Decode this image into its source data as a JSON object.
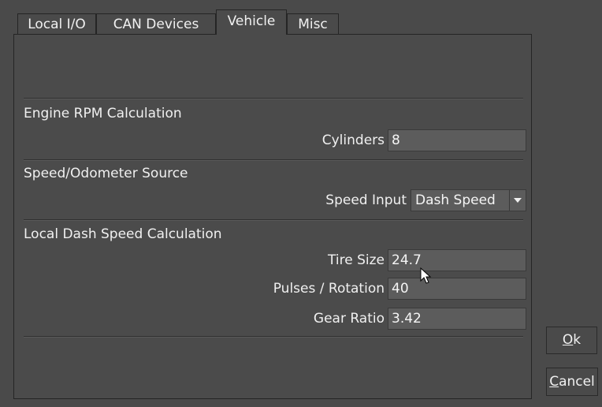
{
  "tabs": [
    {
      "label": "Local I/O"
    },
    {
      "label": "CAN Devices"
    },
    {
      "label": "Vehicle"
    },
    {
      "label": "Misc"
    }
  ],
  "sections": {
    "engine": {
      "title": "Engine RPM Calculation",
      "cylinders_label": "Cylinders",
      "cylinders_value": "8"
    },
    "speed_source": {
      "title": "Speed/Odometer Source",
      "speed_input_label": "Speed Input",
      "speed_input_value": "Dash Speed"
    },
    "local_dash": {
      "title": "Local Dash Speed Calculation",
      "tire_size_label": "Tire Size",
      "tire_size_value": "24.7",
      "pulses_label": "Pulses / Rotation",
      "pulses_value": "40",
      "gear_ratio_label": "Gear Ratio",
      "gear_ratio_value": "3.42"
    }
  },
  "buttons": {
    "ok_mnemonic": "O",
    "ok_rest": "k",
    "cancel_mnemonic": "C",
    "cancel_rest": "ancel"
  },
  "icons": {
    "dropdown": "chevron-down-icon",
    "cursor": "mouse-pointer-icon"
  }
}
